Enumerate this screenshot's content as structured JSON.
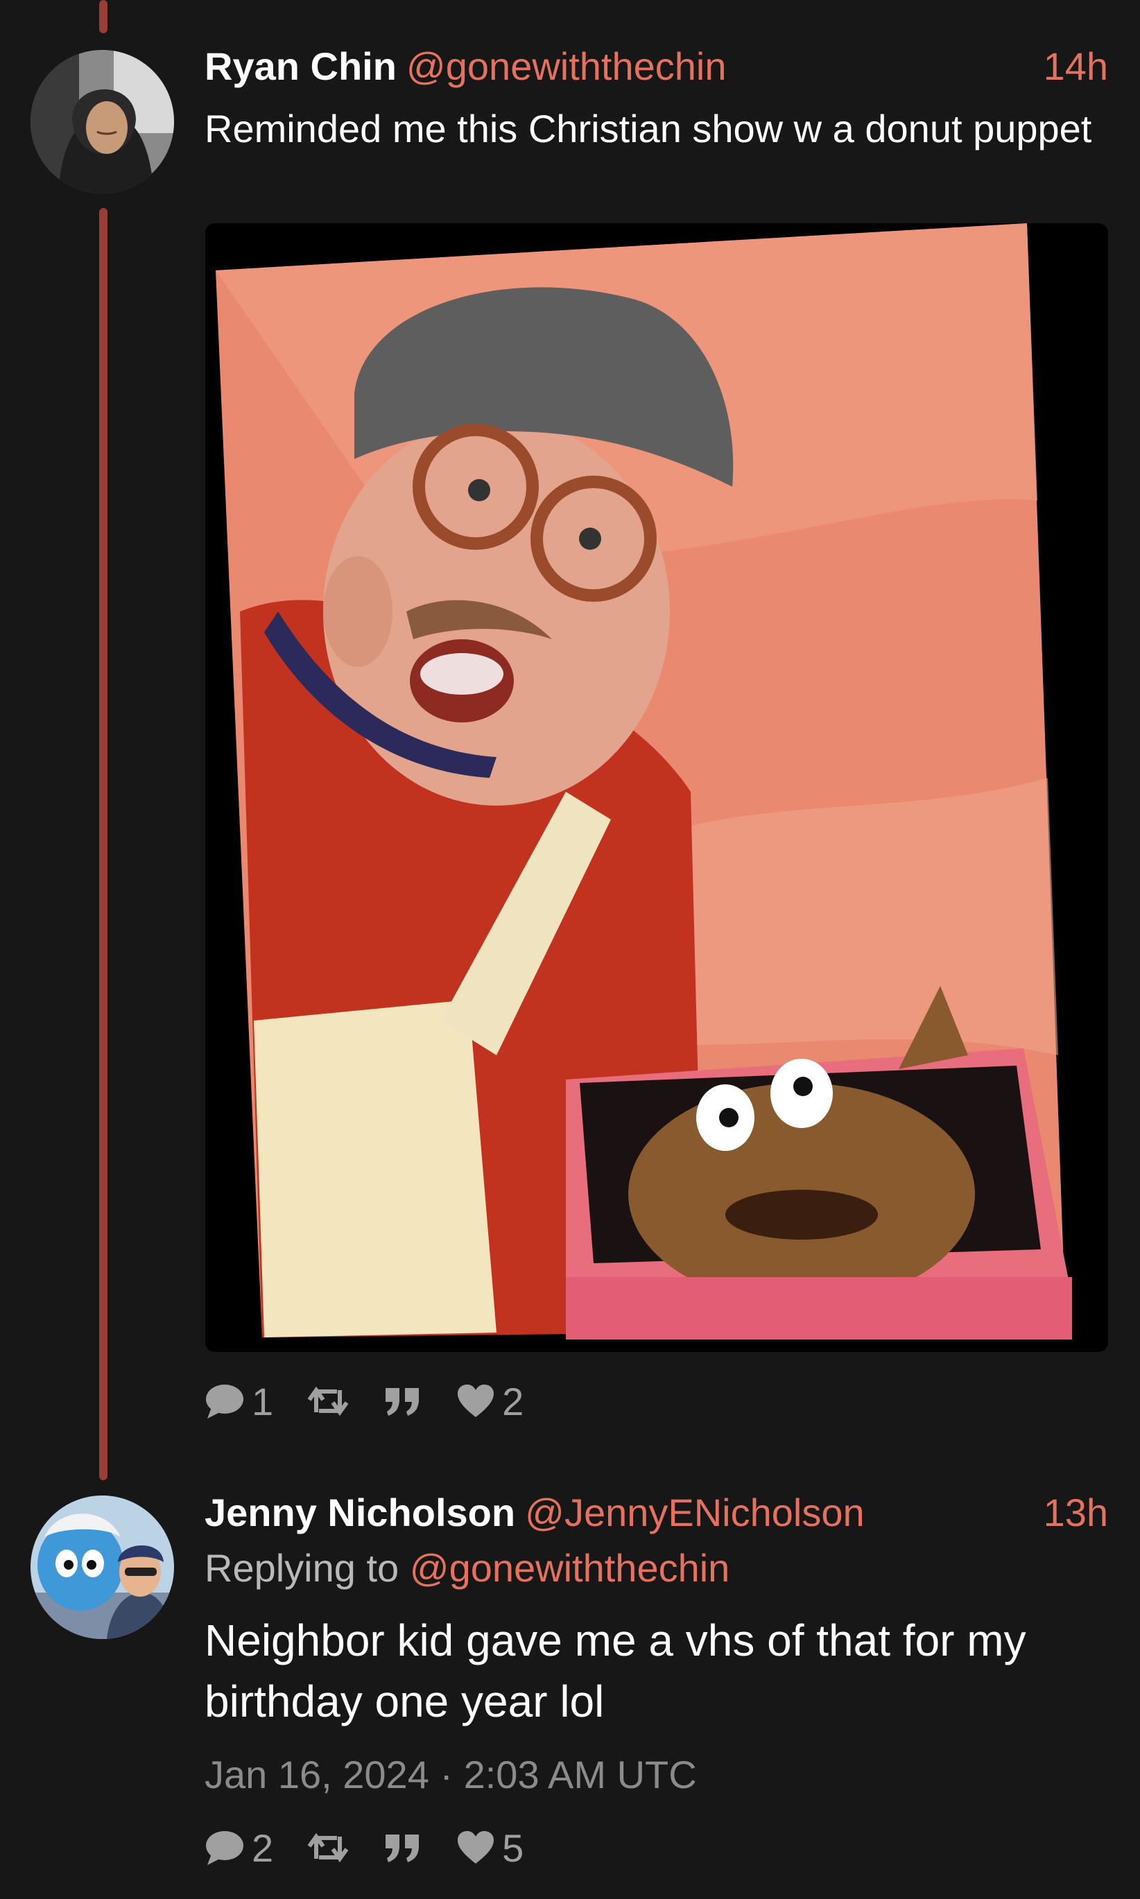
{
  "posts": [
    {
      "author_name": "Ryan Chin",
      "author_handle": "@gonewiththechin",
      "time": "14h",
      "text": "Reminded me this Christian show w a donut puppet",
      "actions": {
        "reply_icon": "speech-bubble-icon",
        "reply_count": "1",
        "repost_icon": "repost-arrows-icon",
        "quote_icon": "quote-marks-icon",
        "like_icon": "heart-icon",
        "like_count": "2"
      }
    },
    {
      "author_name": "Jenny Nicholson",
      "author_handle": "@JennyENicholson",
      "time": "13h",
      "replying_prefix": "Replying to ",
      "replying_handle": "@gonewiththechin",
      "text": "Neighbor kid gave me a vhs of that for my birthday one year lol",
      "date": "Jan 16, 2024 · 2:03 AM UTC",
      "actions": {
        "reply_icon": "speech-bubble-icon",
        "reply_count": "2",
        "repost_icon": "repost-arrows-icon",
        "quote_icon": "quote-marks-icon",
        "like_icon": "heart-icon",
        "like_count": "5"
      }
    }
  ],
  "colors": {
    "background": "#171717",
    "accent": "#e5715e",
    "thread_line": "#9a3d36",
    "muted_text": "#a0a0a0"
  }
}
